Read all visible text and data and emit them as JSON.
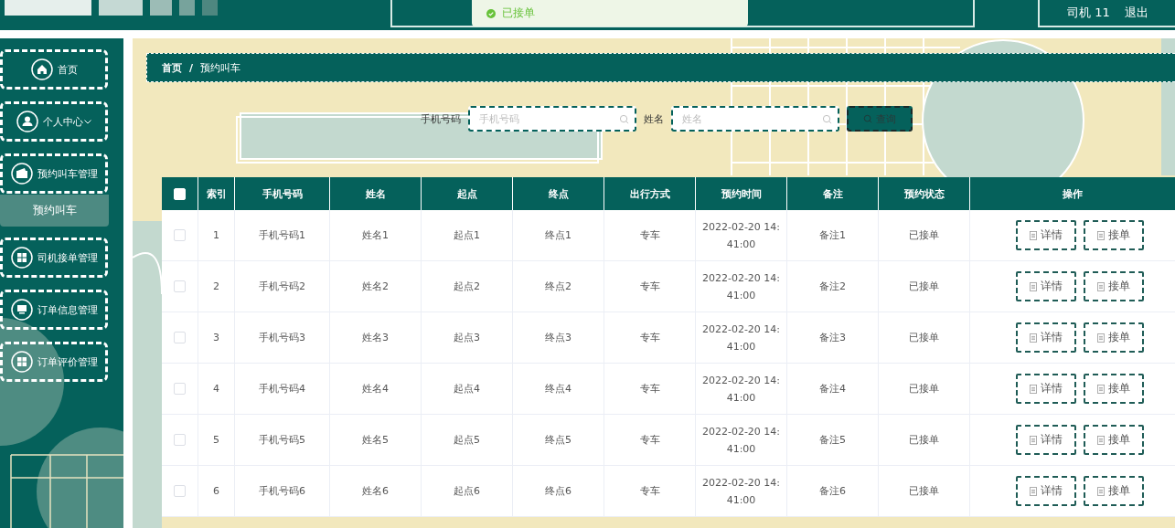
{
  "toast": {
    "text": "已接单"
  },
  "header": {
    "user": "司机 11",
    "logout": "退出"
  },
  "sidebar": {
    "items": [
      {
        "label": "首页",
        "kind": "home",
        "has_caret": false
      },
      {
        "label": "个人中心",
        "kind": "user",
        "has_caret": true
      },
      {
        "label": "预约叫车管理",
        "kind": "wallet",
        "has_caret": false,
        "children": [
          {
            "label": "预约叫车",
            "selected": true
          }
        ]
      },
      {
        "label": "司机接单管理",
        "kind": "grid",
        "has_caret": false
      },
      {
        "label": "订单信息管理",
        "kind": "monitor",
        "has_caret": false
      },
      {
        "label": "订单评价管理",
        "kind": "grid",
        "has_caret": false
      }
    ]
  },
  "breadcrumb": {
    "separator": "/",
    "items": [
      "首页",
      "预约叫车"
    ]
  },
  "search": {
    "fields": [
      {
        "label": "手机号码",
        "placeholder": "手机号码"
      },
      {
        "label": "姓名",
        "placeholder": "姓名"
      }
    ],
    "button": "查询"
  },
  "table": {
    "columns": [
      "索引",
      "手机号码",
      "姓名",
      "起点",
      "终点",
      "出行方式",
      "预约时间",
      "备注",
      "预约状态",
      "操作"
    ],
    "all_checked": false,
    "rows": [
      {
        "checked": false,
        "cells": [
          "1",
          "手机号码1",
          "姓名1",
          "起点1",
          "终点1",
          "专车",
          "2022-02-20 14:41:00",
          "备注1",
          "已接单"
        ],
        "actions": [
          "详情",
          "接单"
        ]
      },
      {
        "checked": false,
        "cells": [
          "2",
          "手机号码2",
          "姓名2",
          "起点2",
          "终点2",
          "专车",
          "2022-02-20 14:41:00",
          "备注2",
          "已接单"
        ],
        "actions": [
          "详情",
          "接单"
        ]
      },
      {
        "checked": false,
        "cells": [
          "3",
          "手机号码3",
          "姓名3",
          "起点3",
          "终点3",
          "专车",
          "2022-02-20 14:41:00",
          "备注3",
          "已接单"
        ],
        "actions": [
          "详情",
          "接单"
        ]
      },
      {
        "checked": false,
        "cells": [
          "4",
          "手机号码4",
          "姓名4",
          "起点4",
          "终点4",
          "专车",
          "2022-02-20 14:41:00",
          "备注4",
          "已接单"
        ],
        "actions": [
          "详情",
          "接单"
        ]
      },
      {
        "checked": false,
        "cells": [
          "5",
          "手机号码5",
          "姓名5",
          "起点5",
          "终点5",
          "专车",
          "2022-02-20 14:41:00",
          "备注5",
          "已接单"
        ],
        "actions": [
          "详情",
          "接单"
        ]
      },
      {
        "checked": false,
        "cells": [
          "6",
          "手机号码6",
          "姓名6",
          "起点6",
          "终点6",
          "专车",
          "2022-02-20 14:41:00",
          "备注6",
          "已接单"
        ],
        "actions": [
          "详情",
          "接单"
        ]
      }
    ]
  }
}
